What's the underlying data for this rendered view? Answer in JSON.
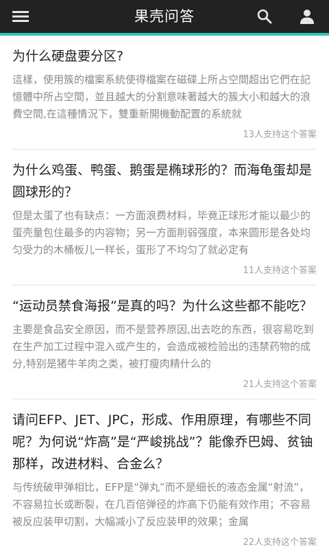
{
  "header": {
    "title": "果壳问答",
    "bg_color": "#222222",
    "accent_color": "#2ec6b1",
    "icons": {
      "menu": "menu-icon",
      "search": "search-icon",
      "user": "user-icon"
    }
  },
  "feed": {
    "items": [
      {
        "title": "为什么硬盘要分区?",
        "excerpt": "這樣，使用簇的檔案系統使得檔案在磁碟上所占空間超出它們在記憶體中所占空間，並且越大的分割意味著越大的簇大小和越大的浪費空間,在這種情況下，雙重新開機動配置的系統就",
        "meta": "13人支持这个答案"
      },
      {
        "title": "为什么鸡蛋、鸭蛋、鹅蛋是椭球形的？而海龟蛋却是圆球形的？",
        "excerpt": "但是太蛋了也有缺点：一方面浪费材料，毕竟正球形才能以最少的蛋壳量包住最多的内容物；另一方面削弱强度，本来圆形是各处均匀受力的木桶板儿一样长，蛋形了不均匀了就必定有",
        "meta": "11人支持这个答案"
      },
      {
        "title": "“运动员禁食海报”是真的吗？为什么这些都不能吃？",
        "excerpt": "主要是食品安全原因，而不是营养原因,出去吃的东西，很容易吃到在生产加工过程中混入或产生的，会造成被检验出的违禁药物的成分,特别是猪牛羊肉之类，被打瘦肉精什么的",
        "meta": "21人支持这个答案"
      },
      {
        "title": "请问EFP、JET、JPC，形成、作用原理，有哪些不同呢？为何说“炸高”是“严峻挑战”？能像乔巴姆、贫铀那样，改进材料、合金么？",
        "excerpt": "与传统破甲弹相比，EFP是“弹丸”而不是细长的液态金属“射流”，不容易拉长或断裂，在几百倍弹径的炸高下仍能有效作用；不容易被反应装甲切割，大幅减小了反应装甲的效果；金属",
        "meta": "22人支持这个答案"
      }
    ]
  }
}
